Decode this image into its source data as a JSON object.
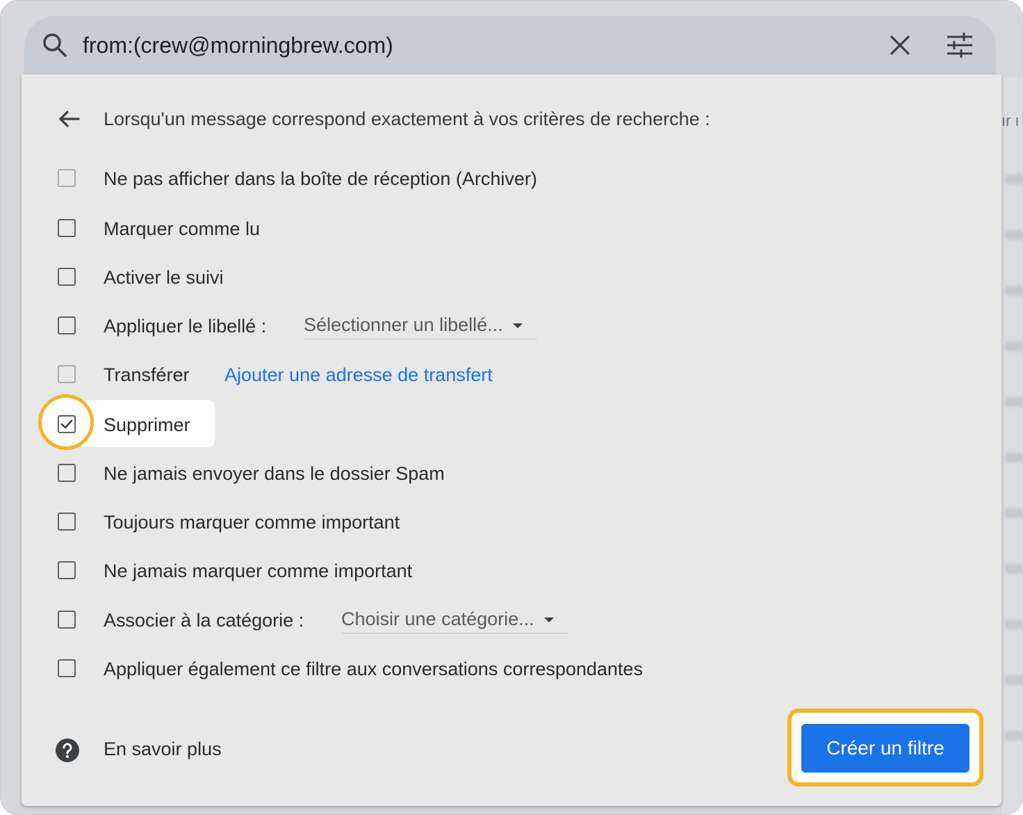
{
  "search": {
    "query": "from:(crew@morningbrew.com)",
    "icons": {
      "search": "search-icon",
      "clear": "close-icon",
      "options": "tune-icon"
    }
  },
  "background_fragment": "ır ı",
  "panel": {
    "heading": "Lorsqu'un message correspond exactement à vos critères de recherche :",
    "options": [
      {
        "label": "Ne pas afficher dans la boîte de réception (Archiver)",
        "checked": false
      },
      {
        "label": "Marquer comme lu",
        "checked": false
      },
      {
        "label": "Activer le suivi",
        "checked": false
      },
      {
        "label": "Appliquer le libellé :",
        "checked": false,
        "select": "Sélectionner un libellé..."
      },
      {
        "label": "Transférer",
        "checked": false,
        "link": "Ajouter une adresse de transfert"
      },
      {
        "label": "Supprimer",
        "checked": true
      },
      {
        "label": "Ne jamais envoyer dans le dossier Spam",
        "checked": false
      },
      {
        "label": "Toujours marquer comme important",
        "checked": false
      },
      {
        "label": "Ne jamais marquer comme important",
        "checked": false
      },
      {
        "label": "Associer à la catégorie :",
        "checked": false,
        "select": "Choisir une catégorie..."
      },
      {
        "label": "Appliquer également ce filtre aux conversations correspondantes",
        "checked": false
      }
    ],
    "help_link": "En savoir plus",
    "create_button": "Créer un filtre"
  },
  "colors": {
    "accent": "#1a73e8",
    "highlight": "#f5b328"
  }
}
